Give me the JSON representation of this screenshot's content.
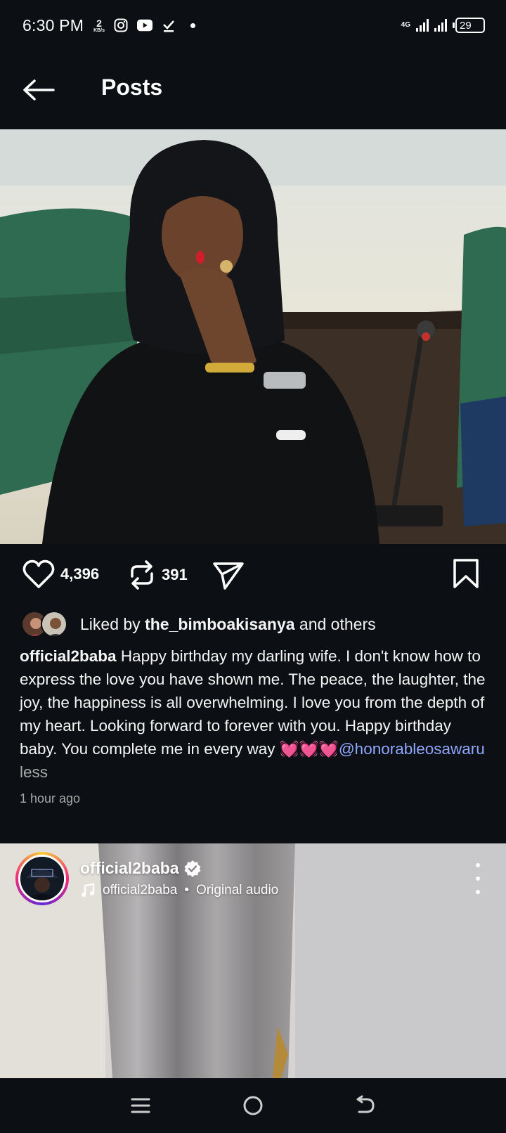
{
  "status_bar": {
    "time": "6:30 PM",
    "net_speed_value": "2",
    "net_speed_unit": "KB/s",
    "network_type": "4G",
    "battery": "29"
  },
  "header": {
    "title": "Posts"
  },
  "post": {
    "likes": "4,396",
    "reposts": "391",
    "liked_by_prefix": "Liked by",
    "liked_by_user": "the_bimboakisanya",
    "liked_by_suffix": "and others",
    "author": "official2baba",
    "caption": "Happy birthday my darling wife. I don't know how to express the love you have shown me. The peace, the laughter, the joy, the happiness is all overwhelming. I love you from the depth of my heart. Looking forward to forever with you. Happy birthday baby. You complete me in every way 💓💓💓",
    "mention": "@honorableosawaru",
    "less_label": "less",
    "time_ago": "1 hour ago"
  },
  "reel": {
    "username": "official2baba",
    "audio_user": "official2baba",
    "audio_separator": "•",
    "audio_label": "Original audio"
  },
  "icons": {
    "back": "arrow-left-icon",
    "like": "heart-icon",
    "repost": "repost-icon",
    "share": "send-icon",
    "save": "bookmark-icon",
    "verified": "verified-badge-icon",
    "music": "music-note-icon",
    "more": "more-vertical-icon",
    "nav_menu": "menu-icon",
    "nav_home": "home-circle-icon",
    "nav_back": "back-icon"
  },
  "colors": {
    "background": "#0c1014",
    "mention": "#8fa6ff",
    "muted": "#a8a8a8"
  }
}
